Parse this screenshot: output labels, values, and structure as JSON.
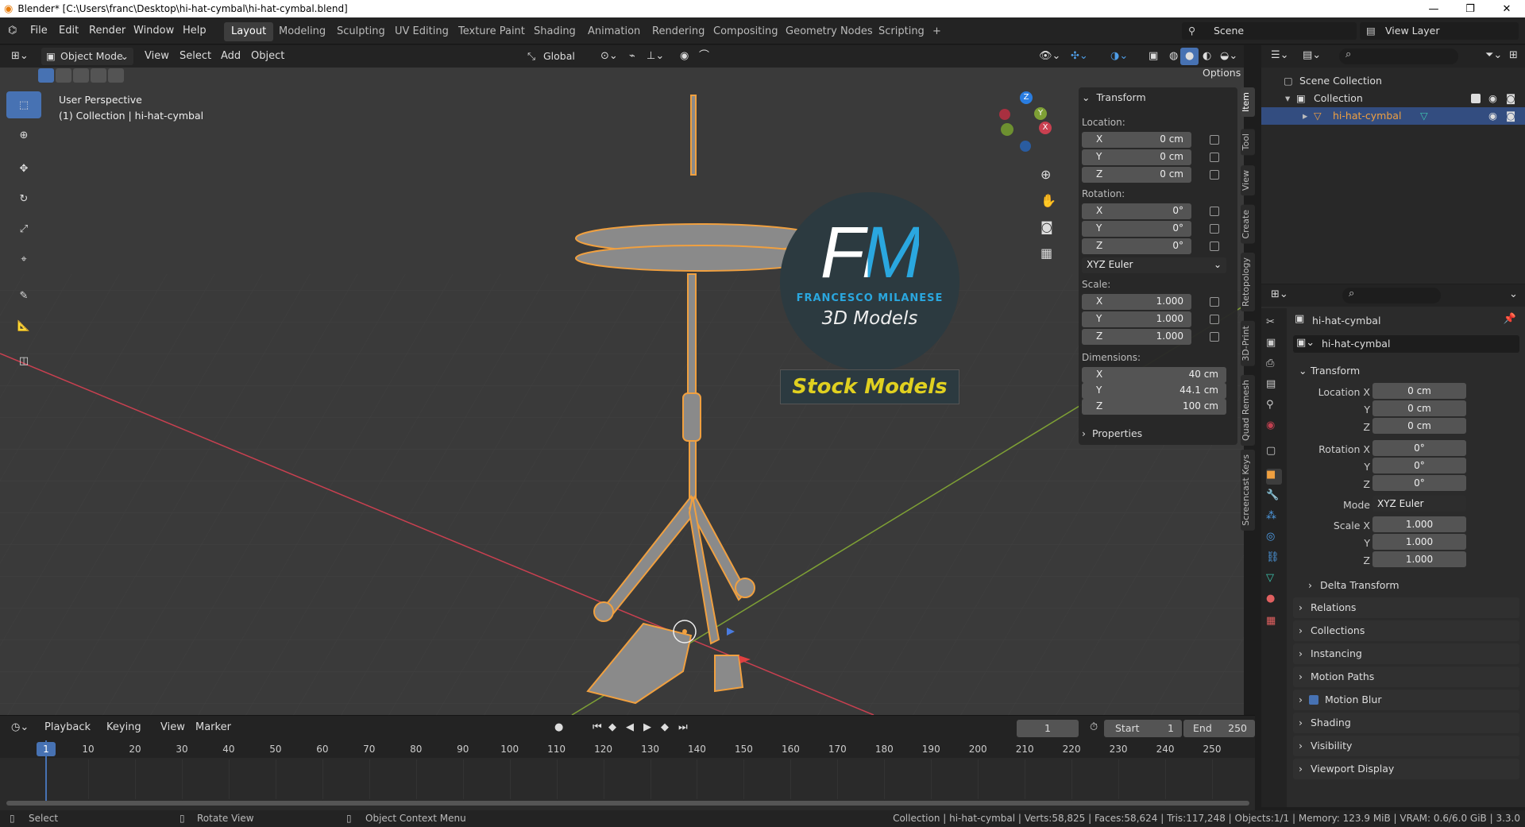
{
  "window": {
    "title": "Blender* [C:\\Users\\franc\\Desktop\\hi-hat-cymbal\\hi-hat-cymbal.blend]",
    "min": "—",
    "max": "❐",
    "close": "✕"
  },
  "menus": [
    "File",
    "Edit",
    "Render",
    "Window",
    "Help"
  ],
  "workspaces": [
    "Layout",
    "Modeling",
    "Sculpting",
    "UV Editing",
    "Texture Paint",
    "Shading",
    "Animation",
    "Rendering",
    "Compositing",
    "Geometry Nodes",
    "Scripting",
    "+"
  ],
  "scene": {
    "name": "Scene",
    "view_layer": "View Layer"
  },
  "viewport_header": {
    "mode": "Object Mode",
    "menus": [
      "View",
      "Select",
      "Add",
      "Object"
    ],
    "orientation": "Global",
    "options": "Options"
  },
  "viewport": {
    "perspective": "User Perspective",
    "collection_info": "(1) Collection | hi-hat-cymbal",
    "watermark_fm": "FM",
    "watermark_name": "FRANCESCO MILANESE",
    "watermark_sub": "3D Models",
    "watermark_badge": "Stock Models",
    "gizmo_axes": [
      "Z",
      "Y",
      "X"
    ]
  },
  "npanel": {
    "title": "Transform",
    "location_label": "Location:",
    "location": [
      {
        "axis": "X",
        "value": "0 cm"
      },
      {
        "axis": "Y",
        "value": "0 cm"
      },
      {
        "axis": "Z",
        "value": "0 cm"
      }
    ],
    "rotation_label": "Rotation:",
    "rotation": [
      {
        "axis": "X",
        "value": "0°"
      },
      {
        "axis": "Y",
        "value": "0°"
      },
      {
        "axis": "Z",
        "value": "0°"
      }
    ],
    "rotation_mode": "XYZ Euler",
    "scale_label": "Scale:",
    "scale": [
      {
        "axis": "X",
        "value": "1.000"
      },
      {
        "axis": "Y",
        "value": "1.000"
      },
      {
        "axis": "Z",
        "value": "1.000"
      }
    ],
    "dimensions_label": "Dimensions:",
    "dimensions": [
      {
        "axis": "X",
        "value": "40 cm"
      },
      {
        "axis": "Y",
        "value": "44.1 cm"
      },
      {
        "axis": "Z",
        "value": "100 cm"
      }
    ],
    "properties": "Properties",
    "tabs": [
      "Item",
      "Tool",
      "View",
      "Create",
      "Retopology",
      "3D-Print",
      "Quad Remesh",
      "Screencast Keys"
    ]
  },
  "outliner": {
    "scene_collection": "Scene Collection",
    "collection": "Collection",
    "object": "hi-hat-cymbal"
  },
  "properties": {
    "object_name": "hi-hat-cymbal",
    "data_name": "hi-hat-cymbal",
    "transform": "Transform",
    "loc_labels": [
      "Location X",
      "Y",
      "Z"
    ],
    "loc_values": [
      "0 cm",
      "0 cm",
      "0 cm"
    ],
    "rot_labels": [
      "Rotation X",
      "Y",
      "Z"
    ],
    "rot_values": [
      "0°",
      "0°",
      "0°"
    ],
    "mode_label": "Mode",
    "mode_value": "XYZ Euler",
    "scale_labels": [
      "Scale X",
      "Y",
      "Z"
    ],
    "scale_values": [
      "1.000",
      "1.000",
      "1.000"
    ],
    "sections": [
      "Delta Transform",
      "Relations",
      "Collections",
      "Instancing",
      "Motion Paths",
      "Motion Blur",
      "Shading",
      "Visibility",
      "Viewport Display"
    ]
  },
  "timeline": {
    "menus": [
      "Playback",
      "Keying",
      "View",
      "Marker"
    ],
    "current_frame": "1",
    "start_label": "Start",
    "start": "1",
    "end_label": "End",
    "end": "250",
    "ticks": [
      "1",
      "10",
      "20",
      "30",
      "40",
      "50",
      "60",
      "70",
      "80",
      "90",
      "100",
      "110",
      "120",
      "130",
      "140",
      "150",
      "160",
      "170",
      "180",
      "190",
      "200",
      "210",
      "220",
      "230",
      "240",
      "250"
    ]
  },
  "statusbar": {
    "select": "Select",
    "rotate": "Rotate View",
    "context": "Object Context Menu",
    "stats": "Collection | hi-hat-cymbal | Verts:58,825 | Faces:58,624 | Tris:117,248 | Objects:1/1 | Memory: 123.9 MiB | VRAM: 0.6/6.0 GiB | 3.3.0"
  },
  "colors": {
    "accent": "#4772b3",
    "selection": "#f0a040",
    "x_axis": "#c94050",
    "y_axis": "#7ea035",
    "watermark_blue": "#2aa7df",
    "badge_yellow": "#e0d020"
  }
}
